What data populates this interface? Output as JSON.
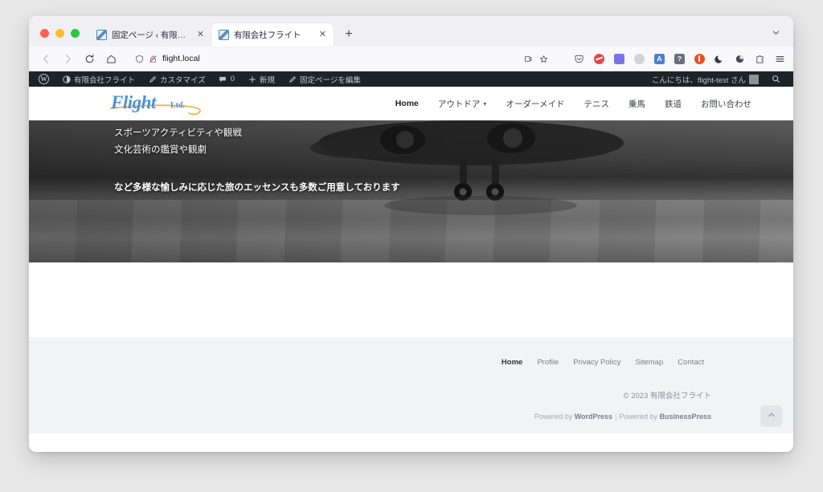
{
  "browser": {
    "tabs": [
      {
        "title": "固定ページ ‹ 有限会社フライト —",
        "favicon": "wordpress-favicon",
        "active": false
      },
      {
        "title": "有限会社フライト",
        "favicon": "wordpress-favicon",
        "active": true
      }
    ],
    "new_tab_label": "+",
    "tab_list_icon": "chevron-down-icon",
    "nav": {
      "back_label": "←",
      "forward_label": "→",
      "reload_label": "⟳",
      "home_label": "⌂"
    },
    "url": "flight.local",
    "url_shield_icon": "shield-icon",
    "url_lock_icon": "lock-crossed-icon",
    "reader_icon": "reader-view-icon",
    "bookmark_icon": "star-icon",
    "extensions": [
      "pocket-icon",
      "adblock-icon",
      "document-icon",
      "github-icon",
      "translate-icon",
      "help-icon",
      "privacy-badger-icon",
      "dark-reader-icon",
      "history-pie-icon",
      "puzzle-icon"
    ],
    "menu_icon": "hamburger-menu-icon"
  },
  "adminbar": {
    "wp_logo": "wordpress-logo",
    "site_name": "有限会社フライト",
    "site_icon": "dashboard-icon",
    "customize": "カスタマイズ",
    "customize_icon": "pencil-icon",
    "comments_icon": "comment-icon",
    "comments_count": "0",
    "new_icon": "plus-icon",
    "new_label": "新規",
    "edit_icon": "edit-icon",
    "edit_label": "固定ページを編集",
    "greeting": "こんにちは、flight-test さん",
    "avatar": "user-avatar",
    "search_icon": "search-icon"
  },
  "site": {
    "logo": {
      "name": "Flight",
      "suffix": "Ltd.",
      "color": "#4a90d9",
      "accent": "#e9b64d"
    },
    "nav": [
      {
        "label": "Home",
        "active": true,
        "has_dropdown": false
      },
      {
        "label": "アウトドア",
        "active": false,
        "has_dropdown": true
      },
      {
        "label": "オーダーメイド",
        "active": false,
        "has_dropdown": false
      },
      {
        "label": "テニス",
        "active": false,
        "has_dropdown": false
      },
      {
        "label": "乗馬",
        "active": false,
        "has_dropdown": false
      },
      {
        "label": "鉄道",
        "active": false,
        "has_dropdown": false
      },
      {
        "label": "お問い合わせ",
        "active": false,
        "has_dropdown": false
      }
    ],
    "hero": {
      "line1": "スポーツアクティビティや観戦",
      "line2": "文化芸術の鑑賞や観劇",
      "line3": "など多様な愉しみに応じた旅のエッセンスも多数ご用意しております",
      "image": "airplane-landing-grayscale-photo"
    },
    "footer": {
      "nav": [
        {
          "label": "Home",
          "active": true
        },
        {
          "label": "Profile",
          "active": false
        },
        {
          "label": "Privacy Policy",
          "active": false
        },
        {
          "label": "Sitemap",
          "active": false
        },
        {
          "label": "Contact",
          "active": false
        }
      ],
      "copyright": "© 2023 有限会社フライト",
      "credit_prefix": "Powered by ",
      "credit_wordpress": "WordPress",
      "credit_separator": "|",
      "credit_prefix2": "Powered by ",
      "credit_theme": "BusinessPress",
      "to_top_icon": "chevron-up-icon"
    }
  }
}
